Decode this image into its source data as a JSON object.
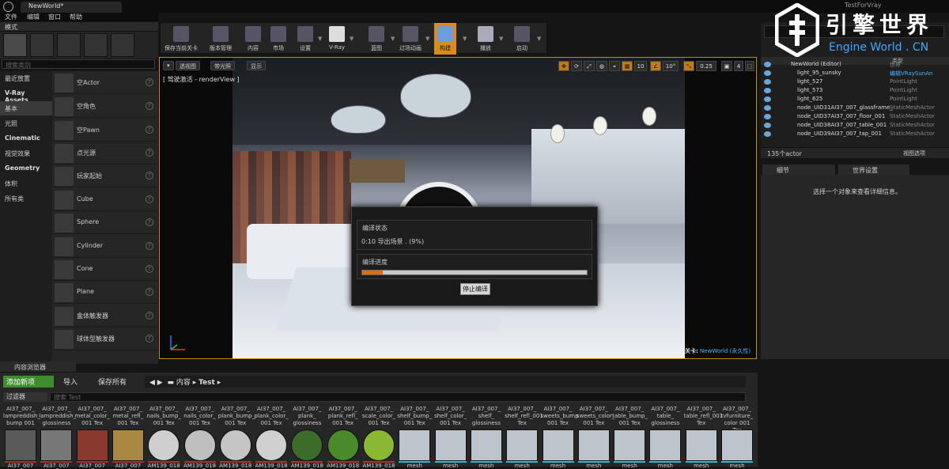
{
  "window": {
    "title": "NewWorld*",
    "project": "TestForVray"
  },
  "menu": [
    "文件",
    "编辑",
    "窗口",
    "帮助"
  ],
  "modes": {
    "tab": "模式",
    "search_placeholder": "搜索类别",
    "categories": [
      "最近放置",
      "V-Ray Assets",
      "基本",
      "光照",
      "Cinematic",
      "视觉效果",
      "Geometry",
      "体积",
      "所有类"
    ],
    "active_category": "基本",
    "places": [
      "空Actor",
      "空角色",
      "空Pawn",
      "点光源",
      "玩家起始",
      "Cube",
      "Sphere",
      "Cylinder",
      "Cone",
      "Plane",
      "盒体触发器",
      "球体型触发器"
    ]
  },
  "toolbar": {
    "items": [
      "保存当前关卡",
      "版本管理",
      "内容",
      "市场",
      "设置",
      "V-Ray",
      "蓝图",
      "过场动画",
      "构建",
      "播放",
      "启动"
    ],
    "active": "构建"
  },
  "viewport": {
    "buttons": [
      "透视图",
      "带光照",
      "显示"
    ],
    "subtitle": "[ 驾驶激活 - renderView ]",
    "controls": [
      "10",
      "10°",
      "0.25",
      "4"
    ],
    "level_prefix": "关卡:",
    "level_name": "NewWorld (永久性)",
    "scene_text": "VRaySunAndSky"
  },
  "compile_dialog": {
    "status_title": "编译状态",
    "status_text": "0:10  导出场景 . (9%)",
    "progress_title": "编译进度",
    "progress": 0.09,
    "stop_label": "停止编译"
  },
  "outliner": {
    "col_type": "类型",
    "rows": [
      {
        "name": "NewWorld (Editor)",
        "type": "世界"
      },
      {
        "name": "light_95_sunsky",
        "type": "编辑VRaySunAn",
        "link": true
      },
      {
        "name": "light_527",
        "type": "PointLight"
      },
      {
        "name": "light_573",
        "type": "PointLight"
      },
      {
        "name": "light_625",
        "type": "PointLight"
      },
      {
        "name": "node_UID31AI37_007_glassframe_",
        "type": "StaticMeshActor"
      },
      {
        "name": "node_UID37AI37_007_floor_001",
        "type": "StaticMeshActor"
      },
      {
        "name": "node_UID38AI37_007_table_001",
        "type": "StaticMeshActor"
      },
      {
        "name": "node_UID39AI37_007_tap_001",
        "type": "StaticMeshActor"
      }
    ],
    "count": "135个actor",
    "view_options": "视图选项"
  },
  "watermark": {
    "cn": "引擎世界",
    "en": "Engine World . CN"
  },
  "details": {
    "tabs": [
      "细节",
      "世界设置"
    ],
    "hint": "选择一个对象来查看详细信息。"
  },
  "content_browser": {
    "tab": "内容浏览器",
    "add_new": "添加新项",
    "import": "导入",
    "save_all": "保存所有",
    "crumbs": [
      "内容",
      "Test"
    ],
    "filter": "过滤器",
    "search_placeholder": "搜索 Test",
    "assets": [
      {
        "name": "AI37_007_ lampreddish_ bump 001",
        "bottom": "AI37_007"
      },
      {
        "name": "AI37_007_ lampreddish_ glossiness",
        "bottom": "AI37_007"
      },
      {
        "name": "AI37_007_ metal_color_ 001 Tex",
        "bottom": "AI37_007"
      },
      {
        "name": "AI37_007_ metal_refl_ 001 Tex",
        "bottom": "AI37_007"
      },
      {
        "name": "AI37_007_ nails_bump_ 001 Tex",
        "bottom": "AM139_018"
      },
      {
        "name": "AI37_007_ nails_color_ 001 Tex",
        "bottom": "AM139_018"
      },
      {
        "name": "AI37_007_ plank_bump_ 001 Tex",
        "bottom": "AM139_018"
      },
      {
        "name": "AI37_007_ plank_color_ 001 Tex",
        "bottom": "AM139_018"
      },
      {
        "name": "AI37_007_ plank_ glossiness",
        "bottom": "AM139_018"
      },
      {
        "name": "AI37_007_ plank_refl_ 001 Tex",
        "bottom": "AM139_018"
      },
      {
        "name": "AI37_007_ scale_color_ 001 Tex",
        "bottom": "AM139_018"
      },
      {
        "name": "AI37_007_ shelf_bump_ 001 Tex",
        "bottom": "mesh"
      },
      {
        "name": "AI37_007_ shelf_color_ 001 Tex",
        "bottom": "mesh"
      },
      {
        "name": "AI37_007_ shelf_ glossiness",
        "bottom": "mesh"
      },
      {
        "name": "AI37_007_ shelf_refl_001 Tex",
        "bottom": "mesh"
      },
      {
        "name": "AI37_007_ sweets_bump 001 Tex",
        "bottom": "mesh"
      },
      {
        "name": "AI37_007_ sweets_color_ 001 Tex",
        "bottom": "mesh"
      },
      {
        "name": "AI37_007_ table_bump_ 001 Tex",
        "bottom": "mesh"
      },
      {
        "name": "AI37_007_ table_ glossiness",
        "bottom": "mesh"
      },
      {
        "name": "AI37_007_ table_refl_001 Tex",
        "bottom": "mesh"
      },
      {
        "name": "AI37_007_ tvfurniture_ color 001 Tex",
        "bottom": "mesh"
      }
    ]
  }
}
